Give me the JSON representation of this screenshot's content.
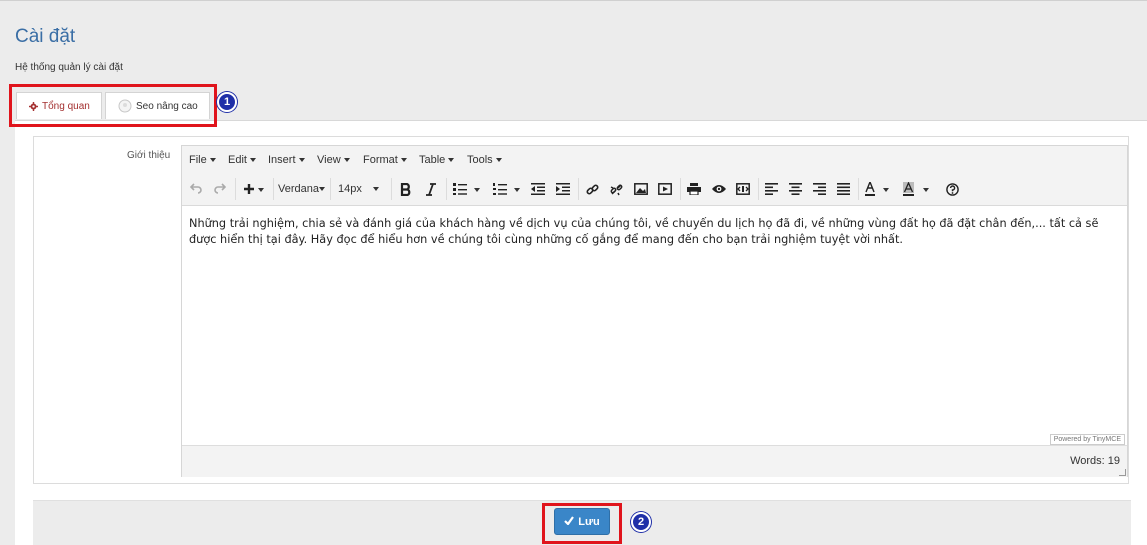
{
  "header": {
    "title": "Cài đặt",
    "subtitle": "Hệ thống quản lý cài đặt"
  },
  "tabs": [
    {
      "label": "Tổng quan",
      "icon": "gear-icon",
      "active": true
    },
    {
      "label": "Seo nâng cao",
      "icon": "seo-icon",
      "active": false
    }
  ],
  "form": {
    "field_label": "Giới thiệu"
  },
  "editor": {
    "menu": [
      "File",
      "Edit",
      "Insert",
      "View",
      "Format",
      "Table",
      "Tools"
    ],
    "font_family": "Verdana",
    "font_size": "14px",
    "content": "Những trải nghiệm, chia sẻ và đánh giá của khách hàng về dịch vụ của chúng tôi, về chuyến du lịch họ đã đi, về những vùng đất họ đã đặt chân đến,... tất cả sẽ được hiển thị tại đây. Hãy đọc để hiểu hơn về chúng tôi cùng những cố gắng để mang đến cho bạn trải nghiệm tuyệt vời nhất.",
    "powered_by": "Powered by TinyMCE",
    "word_count": "Words: 19"
  },
  "actions": {
    "save_label": "Lưu"
  },
  "annotations": {
    "badge1": "1",
    "badge2": "2"
  },
  "colors": {
    "title": "#3a6ea5",
    "active_tab": "#a43030",
    "save_button": "#3a86c8",
    "highlight": "#e0141c",
    "badge": "#1f2fa8"
  }
}
